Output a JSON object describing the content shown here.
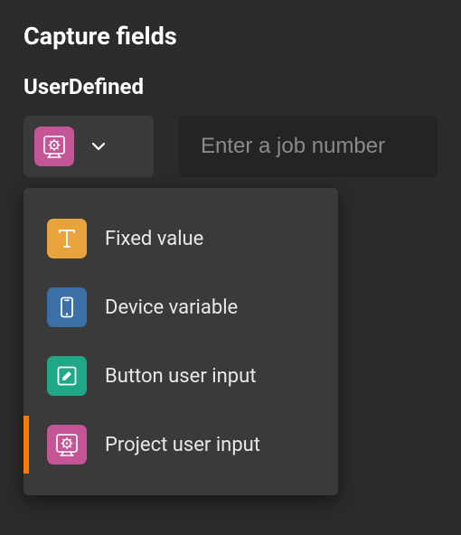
{
  "header": {
    "title": "Capture fields"
  },
  "section": {
    "label": "UserDefined"
  },
  "selector": {
    "current_type": "project-user-input",
    "current_icon": "project-gear-icon"
  },
  "input": {
    "placeholder": "Enter a job number",
    "value": ""
  },
  "menu": {
    "items": [
      {
        "id": "fixed-value",
        "label": "Fixed value",
        "icon": "text-icon",
        "tile_color": "#e8a33d",
        "selected": false
      },
      {
        "id": "device-variable",
        "label": "Device variable",
        "icon": "device-icon",
        "tile_color": "#3a6fa8",
        "selected": false
      },
      {
        "id": "button-user-input",
        "label": "Button user input",
        "icon": "pencil-icon",
        "tile_color": "#1fa787",
        "selected": false
      },
      {
        "id": "project-user-input",
        "label": "Project user input",
        "icon": "project-gear-icon",
        "tile_color": "#c45596",
        "selected": true
      }
    ]
  },
  "colors": {
    "accent": "#ff7a00",
    "bg": "#2b2b2b",
    "panel": "#3a3a3a",
    "input_bg": "#242424"
  }
}
